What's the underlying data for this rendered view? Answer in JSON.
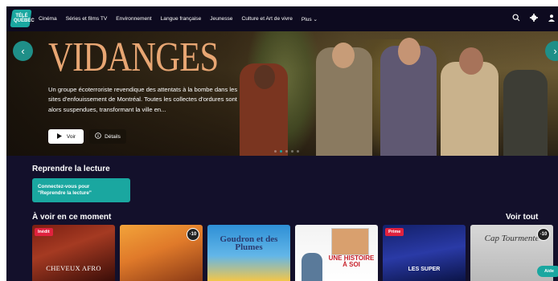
{
  "brand": {
    "logo_text": "TÉLÉ QUÉBEC",
    "accent": "#1aa7a0"
  },
  "nav": {
    "links": [
      "Cinéma",
      "Séries et films TV",
      "Environnement",
      "Langue française",
      "Jeunesse",
      "Culture et Art de vivre",
      "Plus ⌄"
    ],
    "icons": [
      "search-icon",
      "gear-icon",
      "user-icon"
    ]
  },
  "hero": {
    "title": "VIDANGES",
    "description": "Un groupe écoterroriste revendique des attentats à la bombe dans les sites d'enfouissement de Montréal. Toutes les collectes d'ordures sont alors suspendues, transformant la ville en...",
    "play_label": "Voir",
    "details_label": "Détails",
    "prev_icon": "‹",
    "next_icon": "›"
  },
  "continue_watching": {
    "title": "Reprendre la lecture",
    "login_label_line1": "Connectez-vous pour",
    "login_label_line2": "\"Reprendre la lecture\""
  },
  "now_showing": {
    "title": "À voir en ce moment",
    "see_all": "Voir tout",
    "cards": [
      {
        "badge": "Inédit",
        "text": "CHEVEUX AFRO",
        "age": ""
      },
      {
        "badge": "",
        "text": "",
        "age": "-10"
      },
      {
        "badge": "",
        "text": "Goudron et des Plumes",
        "age": ""
      },
      {
        "badge": "",
        "text": "UNE HISTOIRE À SOI",
        "age": ""
      },
      {
        "badge": "Prime",
        "text": "LES SUPER",
        "age": ""
      },
      {
        "badge": "",
        "text": "Cap Tourmente",
        "age": "-10"
      }
    ]
  },
  "help": {
    "label": "Aide"
  }
}
